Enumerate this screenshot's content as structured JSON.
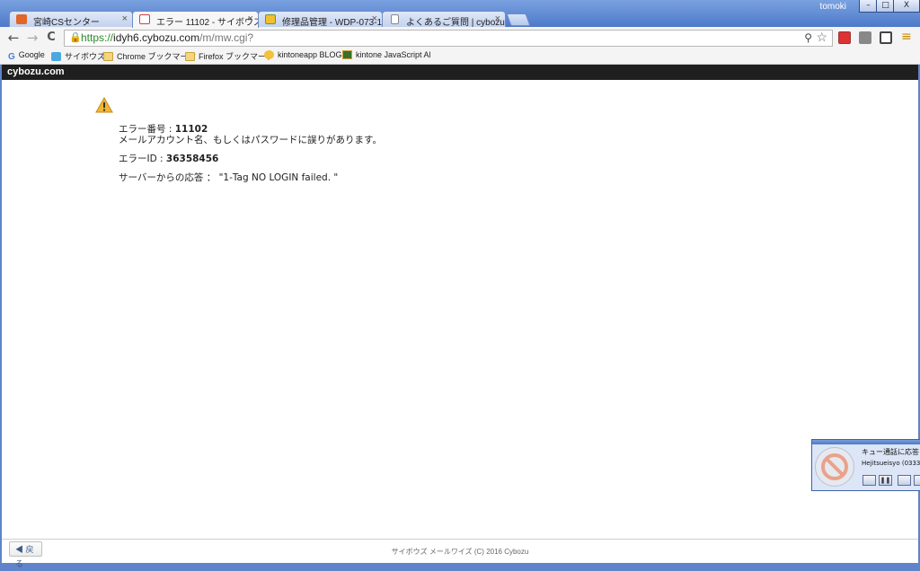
{
  "window": {
    "user_name": "tomoki",
    "minimize": "–",
    "maximize": "□",
    "close": "X"
  },
  "tabs": [
    {
      "label": "宮崎CSセンター",
      "close": "×"
    },
    {
      "label": "エラー 11102 - サイボウズ(R",
      "close": "×"
    },
    {
      "label": "修理品管理 - WDP-073-1(",
      "close": "×"
    },
    {
      "label": "よくあるご質問 | cybozu.com",
      "close": "×"
    }
  ],
  "toolbar": {
    "back": "←",
    "forward": "→",
    "reload": "C",
    "url_scheme": "https://",
    "url_host": "idyh6.cybozu.com",
    "url_path": "/m/mw.cgi?",
    "lock": "🔒",
    "zoom": "⚲",
    "star": "☆",
    "menu": "≡"
  },
  "bookmarks": [
    {
      "label": "Google"
    },
    {
      "label": "サイボウズ"
    },
    {
      "label": "Chrome ブックマーク"
    },
    {
      "label": "Firefox ブックマーク"
    },
    {
      "label": "kintoneapp BLOG"
    },
    {
      "label": "kintone JavaScript API"
    }
  ],
  "site": {
    "brand": "cybozu.com"
  },
  "error": {
    "number_label": "エラー番号 : ",
    "number": "11102",
    "message": "メールアカウント名、もしくはパスワードに誤りがあります。",
    "id_label": "エラーID : ",
    "id": "36358456",
    "server_response": "サーバーからの応答 ： \"1-Tag NO LOGIN failed. \""
  },
  "footer": {
    "back_button": "◀ 戻る",
    "copyright": "サイボウズ メールワイズ (C) 2016 Cybozu"
  },
  "notification": {
    "title": "キュー通話に応答し",
    "subtitle": "Hejitsueisyo (0333"
  },
  "colors": {
    "window_frame": "#5f84c9",
    "site_bar": "#1f1f1f",
    "warning": "#f2b632",
    "url_secure": "#2a8a2a"
  }
}
